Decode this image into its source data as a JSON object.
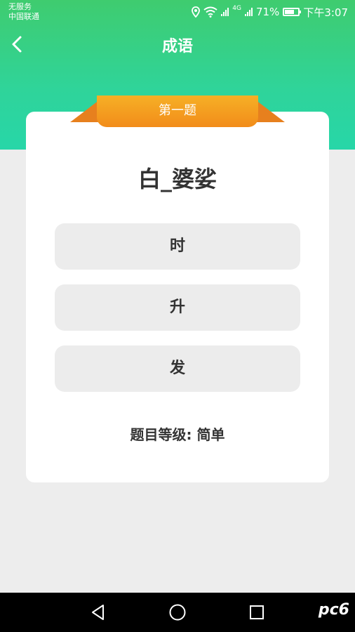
{
  "status_bar": {
    "carrier_line1": "无服务",
    "carrier_line2": "中国联通",
    "network": "4G",
    "battery": "71%",
    "battery_level": 0.71,
    "time": "下午3:07"
  },
  "header": {
    "title": "成语",
    "back_icon": "chevron-left-icon"
  },
  "quiz": {
    "ribbon_label": "第一题",
    "question": "白_婆娑",
    "options": [
      "时",
      "升",
      "发"
    ],
    "level_text": "题目等级: 简单"
  },
  "system_nav": {
    "watermark": "pc6"
  },
  "colors": {
    "header_top": "#3fcc6f",
    "header_bottom": "#27d6a8",
    "ribbon": "#f28c1a",
    "option_bg": "#ececec",
    "background": "#ededed"
  }
}
